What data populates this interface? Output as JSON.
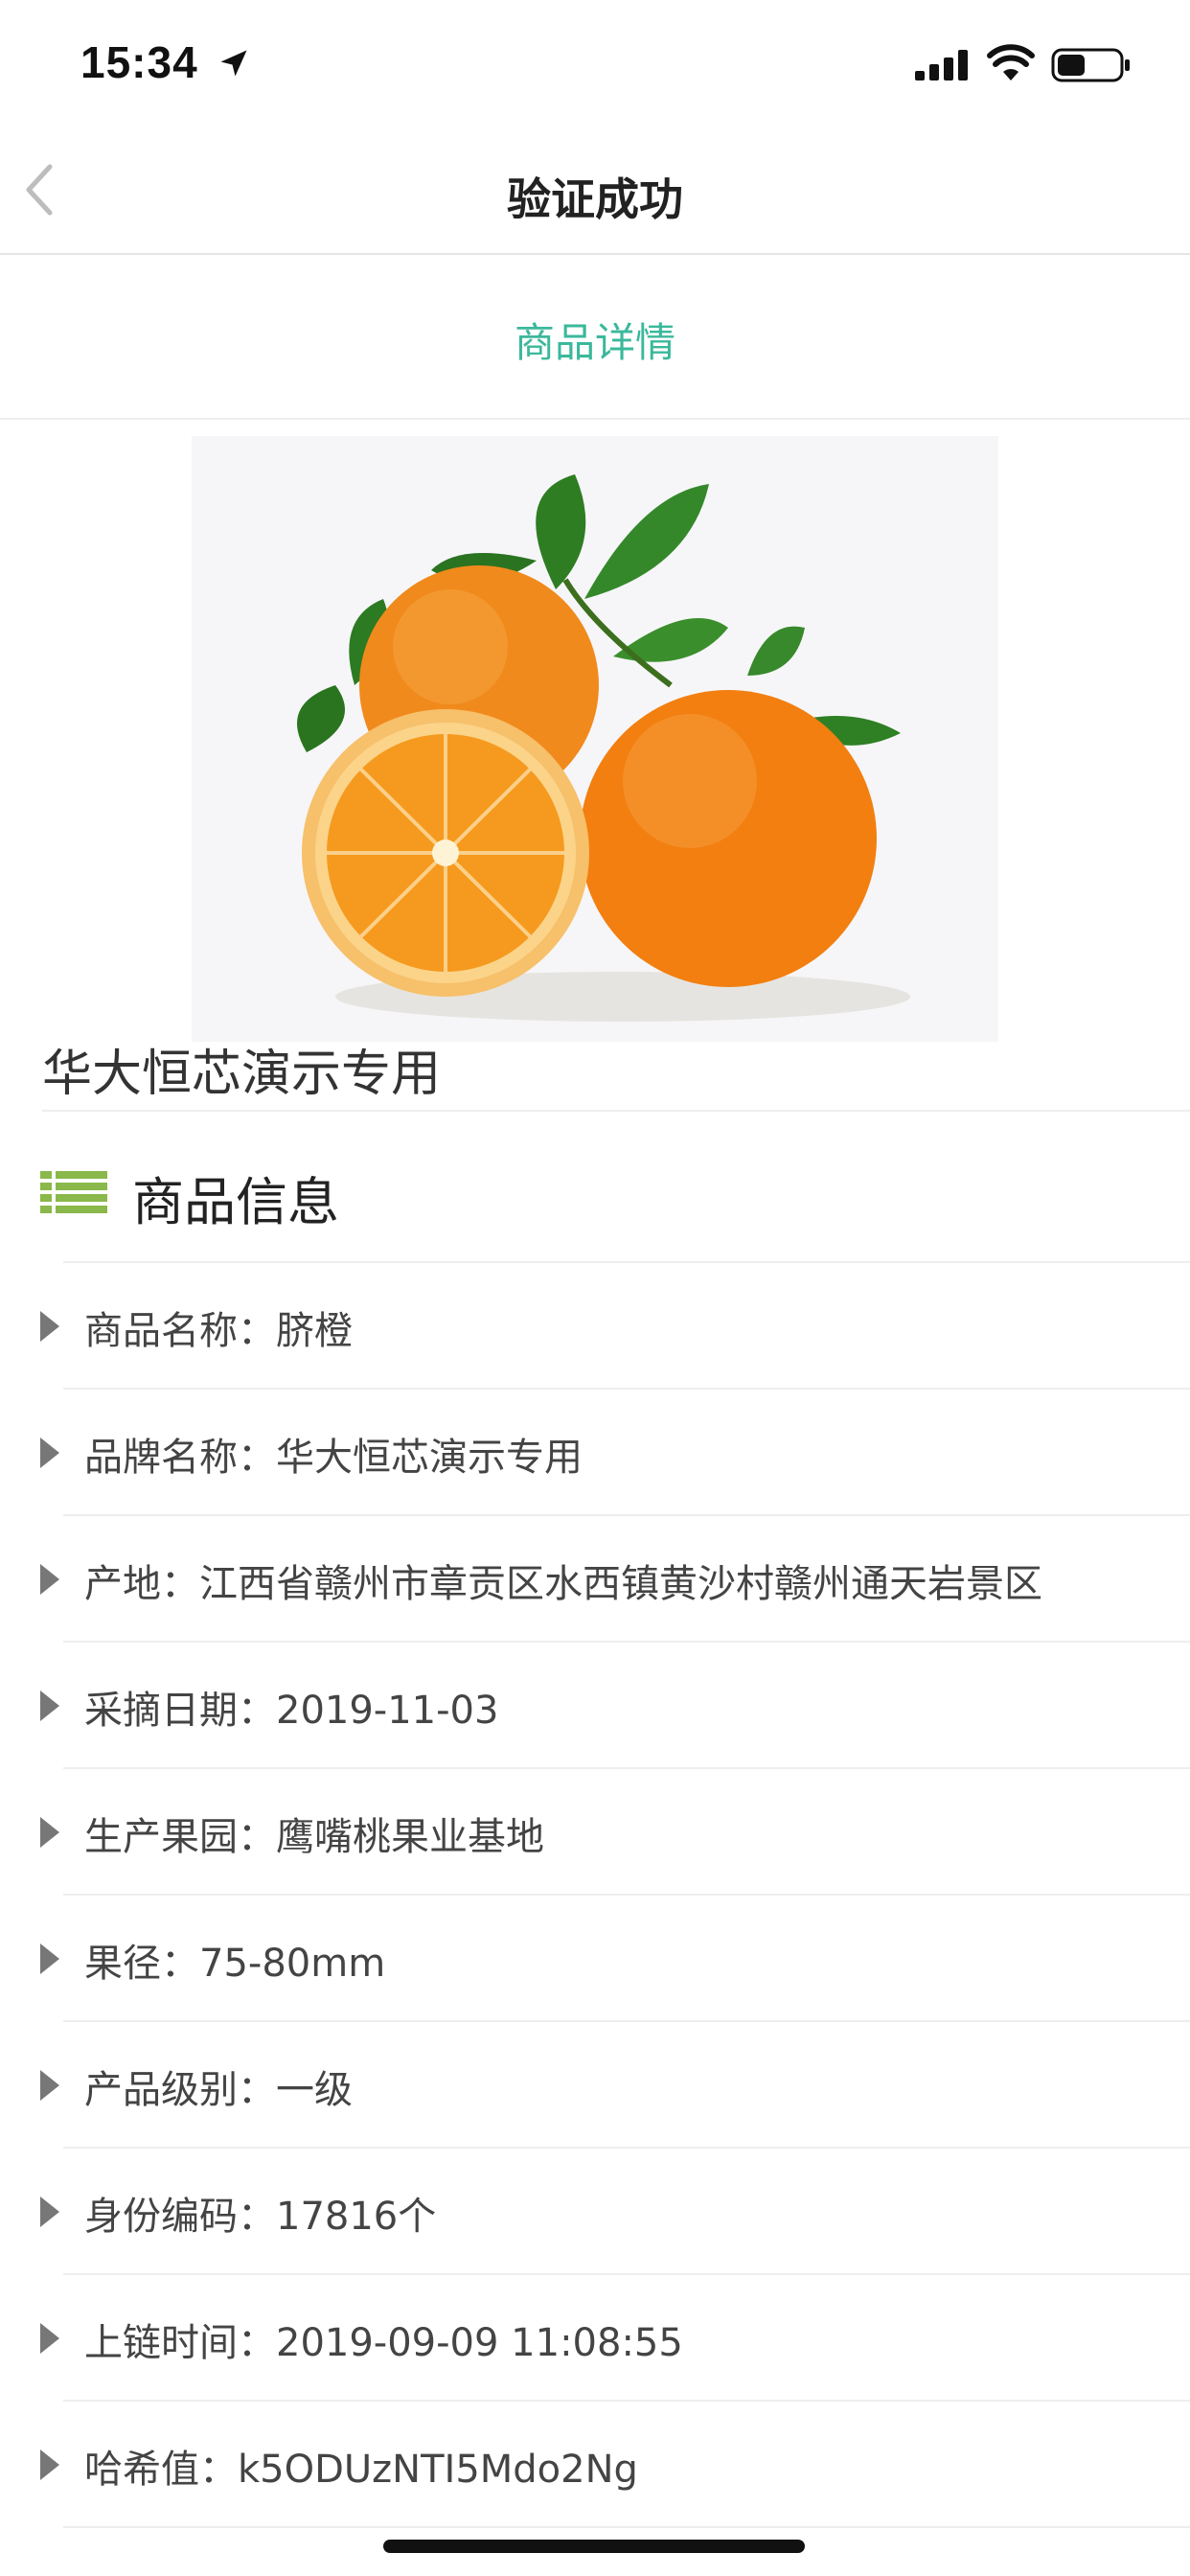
{
  "status_bar": {
    "time": "15:34",
    "icons": [
      "location-arrow-icon",
      "cellular-signal-icon",
      "wifi-icon",
      "battery-icon"
    ],
    "battery_level": 0.45
  },
  "nav": {
    "title": "验证成功",
    "back_icon": "chevron-left-icon"
  },
  "tab": {
    "label": "商品详情",
    "active_color": "#3bb89b"
  },
  "product": {
    "image": "orange-fruit-image",
    "title": "华大恒芯演示专用"
  },
  "info_section": {
    "icon": "list-icon",
    "icon_color": "#8ab84a",
    "title": "商品信息",
    "rows": [
      "商品名称：脐橙",
      "品牌名称：华大恒芯演示专用",
      "产地：江西省赣州市章贡区水西镇黄沙村赣州通天岩景区",
      "采摘日期：2019-11-03",
      "生产果园：鹰嘴桃果业基地",
      "果径：75-80mm",
      "产品级别：一级",
      "身份编码：17816个",
      "上链时间：2019-09-09 11:08:55",
      "哈希值：k5ODUzNTI5Mdo2Ng"
    ]
  }
}
